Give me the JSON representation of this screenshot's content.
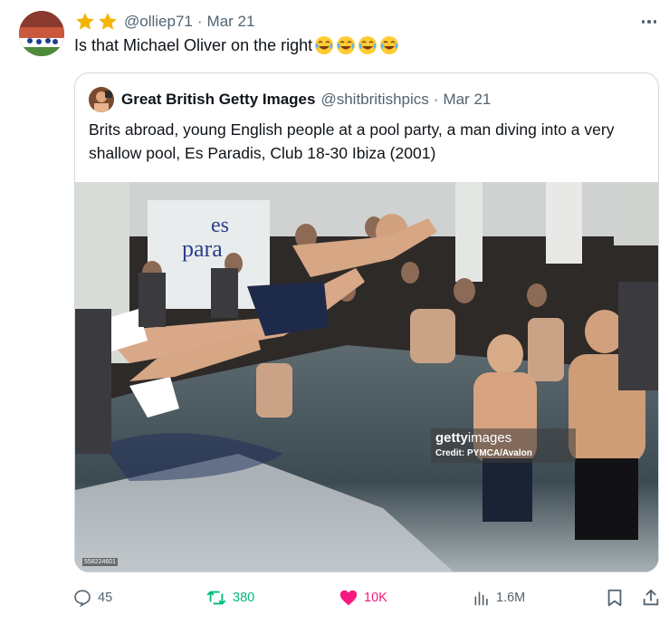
{
  "tweet": {
    "author_handle": "@olliep71",
    "separator": "·",
    "date": "Mar 21",
    "text": "Is that Michael Oliver on the right",
    "emoji_count": 4,
    "emoji_name": "face-with-tears-of-joy"
  },
  "quoted": {
    "display_name": "Great British Getty Images",
    "handle": "@shitbritishpics",
    "separator": "·",
    "date": "Mar 21",
    "text": "Brits abroad, young English people at a pool party, a man diving into a very shallow pool, Es Paradis, Club 18-30 Ibiza (2001)",
    "photo": {
      "watermark_brand_bold": "getty",
      "watermark_brand_light": "images",
      "watermark_credit": "Credit: PYMCA/Avalon",
      "image_id": "558224601",
      "sign_text_1": "es",
      "sign_text_2": "para"
    }
  },
  "actions": {
    "replies": "45",
    "retweets": "380",
    "likes": "10K",
    "views": "1.6M"
  },
  "colors": {
    "retweet_green": "#00ba7c",
    "like_pink": "#f91880",
    "muted_gray": "#536471",
    "star_gold": "#f4b400"
  }
}
